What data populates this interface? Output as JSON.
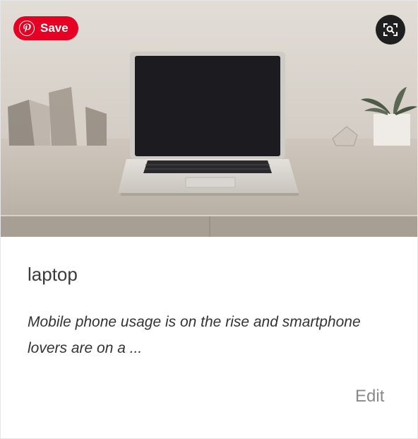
{
  "pin_button": {
    "label": "Save",
    "icon": "pinterest-logo-icon",
    "color": "#e60023"
  },
  "lens_button": {
    "icon": "visual-search-icon"
  },
  "card": {
    "title": "laptop",
    "description": "Mobile phone usage is on the rise and smartphone lovers are on a ...",
    "edit_label": "Edit"
  },
  "image": {
    "subject": "laptop-on-desk-photo"
  }
}
